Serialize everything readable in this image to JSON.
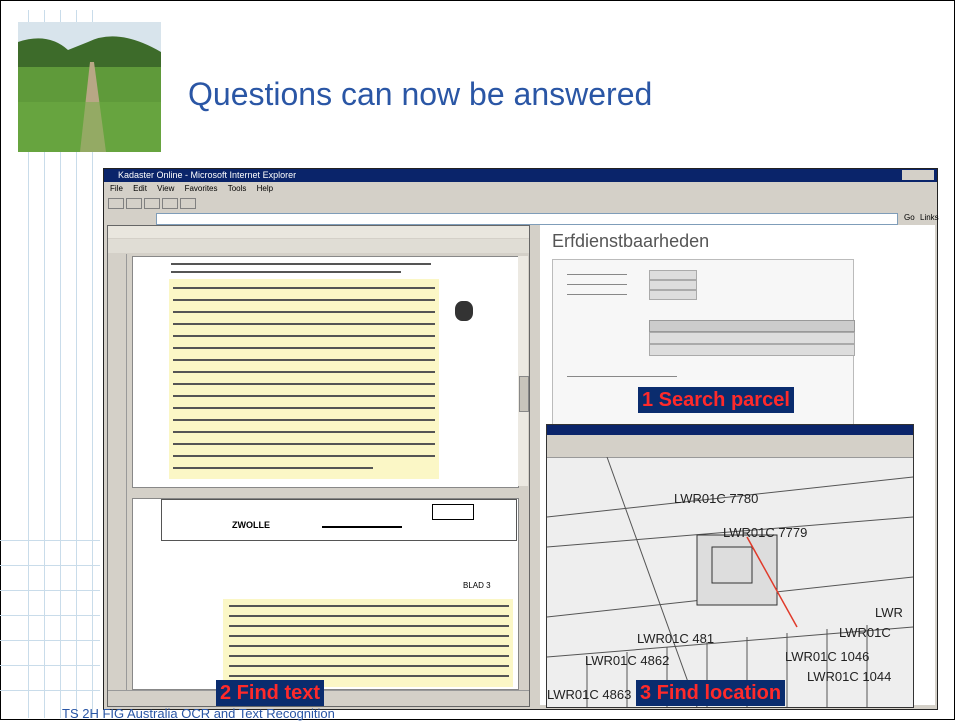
{
  "slide": {
    "title": "Questions can now be answered",
    "footer": "TS 2H FIG Australia OCR and Text Recognition"
  },
  "callouts": {
    "search": "1 Search parcel",
    "text": "2 Find text",
    "location": "3 Find location"
  },
  "browser_window": {
    "title": "Kadaster Online - Microsoft Internet Explorer",
    "menu": [
      "File",
      "Edit",
      "View",
      "Favorites",
      "Tools",
      "Help"
    ],
    "go_label": "Go",
    "links_label": "Links"
  },
  "web_panel": {
    "heading": "Erfdienstbaarheden"
  },
  "map_parcels": [
    "LWR01C 7780",
    "LWR01C 7779",
    "LWR01C 481",
    "LWR01C 4862",
    "LWR01C 1046",
    "LWR01C 4863",
    "LWR01C 1044",
    "LWR01C",
    "LWR"
  ],
  "document": {
    "city": "ZWOLLE",
    "page_label": "BLAD 3"
  },
  "colors": {
    "title": "#2a56a5",
    "callout_bg": "#0a2c6e",
    "callout_text": "#ff2a2a"
  }
}
